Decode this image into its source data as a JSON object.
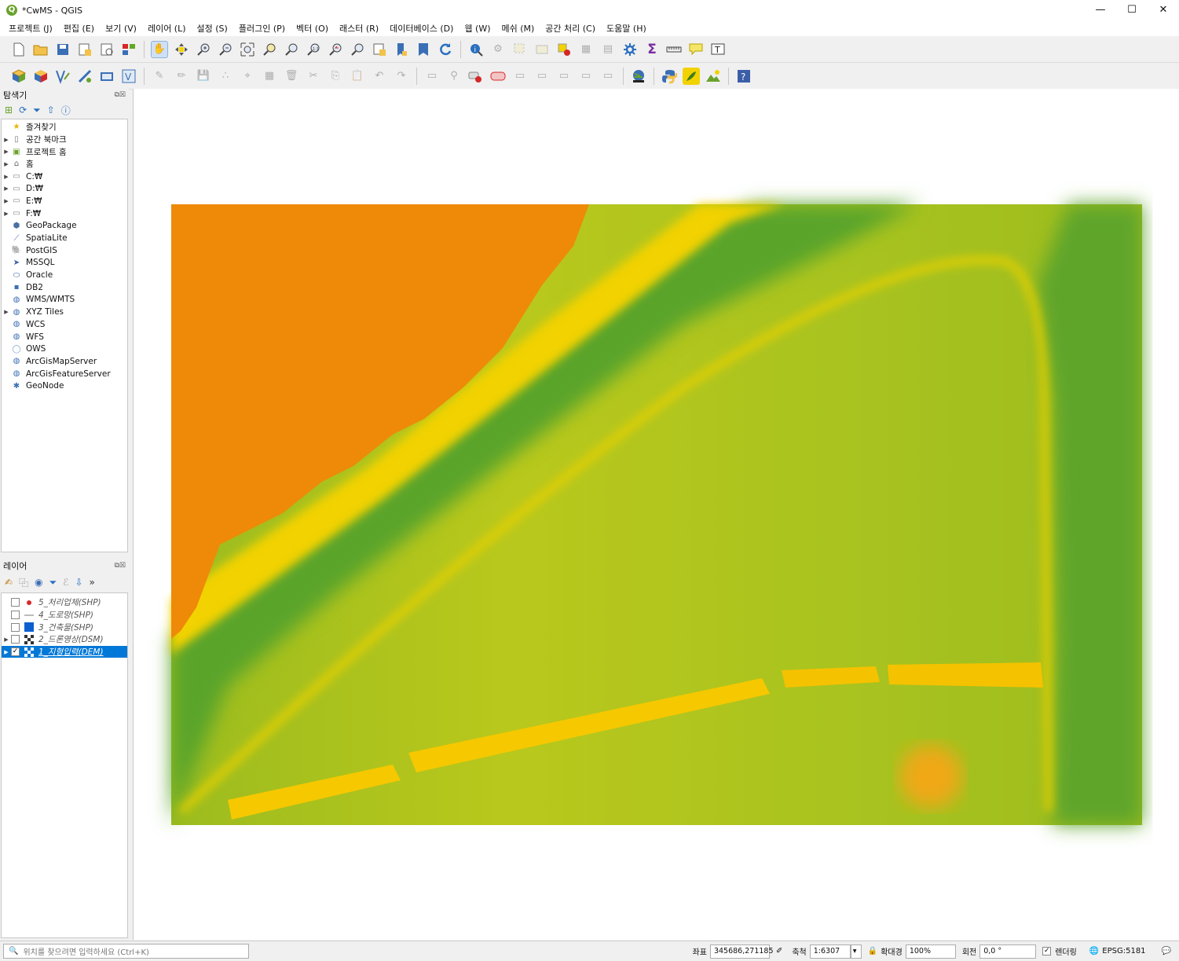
{
  "app": {
    "title": "*CwMS - QGIS"
  },
  "window_controls": {
    "minimize": "—",
    "maximize": "☐",
    "close": "✕"
  },
  "menu": [
    "프로젝트 (J)",
    "편집 (E)",
    "보기 (V)",
    "레이어 (L)",
    "설정 (S)",
    "플러그인 (P)",
    "벡터 (O)",
    "래스터 (R)",
    "데이터베이스 (D)",
    "웹 (W)",
    "메쉬 (M)",
    "공간 처리 (C)",
    "도움말 (H)"
  ],
  "browser": {
    "title": "탐색기",
    "items": [
      {
        "label": "즐겨찾기",
        "icon": "star-icon",
        "expandable": false
      },
      {
        "label": "공간 북마크",
        "icon": "bookmark-icon",
        "expandable": true
      },
      {
        "label": "프로젝트 홈",
        "icon": "project-home-icon",
        "expandable": true
      },
      {
        "label": "홈",
        "icon": "home-icon",
        "expandable": true
      },
      {
        "label": "C:₩",
        "icon": "folder-icon",
        "expandable": true
      },
      {
        "label": "D:₩",
        "icon": "folder-icon",
        "expandable": true
      },
      {
        "label": "E:₩",
        "icon": "folder-icon",
        "expandable": true
      },
      {
        "label": "F:₩",
        "icon": "folder-icon",
        "expandable": true
      },
      {
        "label": "GeoPackage",
        "icon": "geopackage-icon",
        "expandable": false
      },
      {
        "label": "SpatiaLite",
        "icon": "spatialite-icon",
        "expandable": false
      },
      {
        "label": "PostGIS",
        "icon": "postgis-icon",
        "expandable": false
      },
      {
        "label": "MSSQL",
        "icon": "mssql-icon",
        "expandable": false
      },
      {
        "label": "Oracle",
        "icon": "oracle-icon",
        "expandable": false
      },
      {
        "label": "DB2",
        "icon": "db2-icon",
        "expandable": false
      },
      {
        "label": "WMS/WMTS",
        "icon": "wms-icon",
        "expandable": false
      },
      {
        "label": "XYZ Tiles",
        "icon": "xyz-icon",
        "expandable": true
      },
      {
        "label": "WCS",
        "icon": "wcs-icon",
        "expandable": false
      },
      {
        "label": "WFS",
        "icon": "wfs-icon",
        "expandable": false
      },
      {
        "label": "OWS",
        "icon": "ows-icon",
        "expandable": false
      },
      {
        "label": "ArcGisMapServer",
        "icon": "arcgis-map-icon",
        "expandable": false
      },
      {
        "label": "ArcGisFeatureServer",
        "icon": "arcgis-feature-icon",
        "expandable": false
      },
      {
        "label": "GeoNode",
        "icon": "geonode-icon",
        "expandable": false
      }
    ]
  },
  "layers_panel": {
    "title": "레이어",
    "layers": [
      {
        "name": "5_처리업체(SHP)",
        "checked": false,
        "symbol": "point",
        "color": "#d62728",
        "selected": false
      },
      {
        "name": "4_도로망(SHP)",
        "checked": false,
        "symbol": "line",
        "color": "#777777",
        "selected": false
      },
      {
        "name": "3_건축물(SHP)",
        "checked": false,
        "symbol": "polygon",
        "color": "#0d5fd0",
        "selected": false
      },
      {
        "name": "2_드론영상(DSM)",
        "checked": false,
        "symbol": "raster",
        "color": "#333333",
        "selected": false
      },
      {
        "name": "1_지형입력(DEM)",
        "checked": true,
        "symbol": "raster",
        "color": "#333333",
        "selected": true
      }
    ]
  },
  "statusbar": {
    "locator_placeholder": "위치를 찾으려면 입력하세요 (Ctrl+K)",
    "coord_label": "좌표",
    "coord_value": "345686,271185",
    "scale_label": "축척",
    "scale_value": "1:6307",
    "magnifier_label": "확대경",
    "magnifier_value": "100%",
    "rotation_label": "회전",
    "rotation_value": "0,0 °",
    "render_label": "렌더링",
    "render_checked": true,
    "crs": "EPSG:5181"
  },
  "colors": {
    "accent": "#0078d7",
    "dem_high": "#ee8a08",
    "dem_mid": "#f2d200",
    "dem_low": "#63a924"
  }
}
